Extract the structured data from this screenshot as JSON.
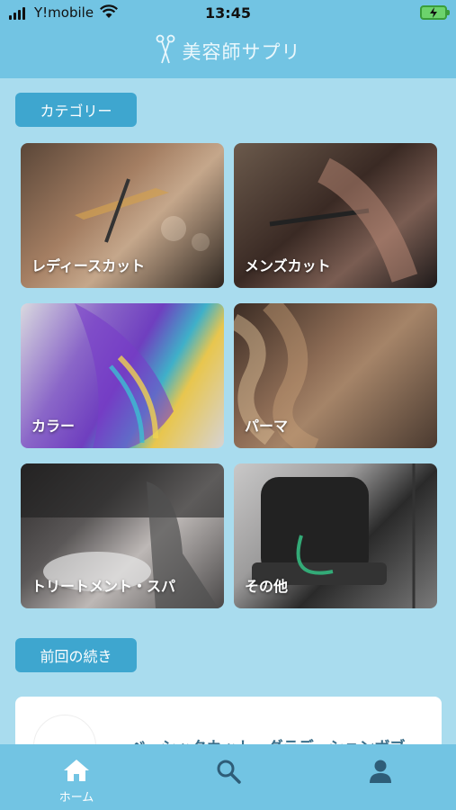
{
  "status_bar": {
    "carrier": "Y!mobile",
    "time": "13:45"
  },
  "header": {
    "title": "美容師サプリ",
    "icon": "scissors-icon"
  },
  "categories_section": {
    "label": "カテゴリー",
    "items": [
      {
        "label": "レディースカット"
      },
      {
        "label": "メンズカット"
      },
      {
        "label": "カラー"
      },
      {
        "label": "パーマ"
      },
      {
        "label": "トリートメント・スパ"
      },
      {
        "label": "その他"
      }
    ]
  },
  "continue_section": {
    "label": "前回の続き",
    "item_title": "ベーシックカット・グラデーションボブ"
  },
  "bottom_nav": {
    "home_label": "ホーム",
    "home_icon": "home-icon",
    "search_icon": "search-icon",
    "user_icon": "user-icon"
  },
  "colors": {
    "header_bg": "#72c4e3",
    "page_bg": "#a9dcee",
    "pill_bg": "#3ea6cf"
  }
}
